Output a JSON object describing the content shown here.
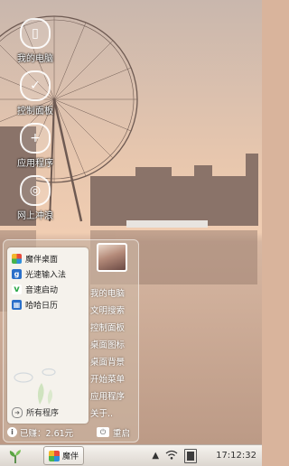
{
  "desktop": {
    "icons": [
      {
        "label": "我的电脑",
        "icon": "phone-icon"
      },
      {
        "label": "控制面板",
        "icon": "check-shield-icon"
      },
      {
        "label": "应用程序",
        "icon": "plus-icon"
      },
      {
        "label": "网上冲浪",
        "icon": "globe-icon"
      }
    ]
  },
  "start_menu": {
    "apps": [
      {
        "label": "魔伴桌面",
        "icon": "pinwheel-icon",
        "color": "#e94b3c"
      },
      {
        "label": "光速输入法",
        "icon": "input-g-icon",
        "color": "#2a6fc9"
      },
      {
        "label": "音速启动",
        "icon": "v-check-icon",
        "color": "#2ea84a"
      },
      {
        "label": "哈哈日历",
        "icon": "calendar-icon",
        "color": "#2a6fc9"
      }
    ],
    "all_programs": "所有程序",
    "side_items": [
      "我的电脑",
      "文明搜索",
      "控制面板",
      "桌面图标",
      "桌面背景",
      "开始菜单",
      "应用程序",
      "关于.."
    ],
    "footer": {
      "earned": "已赚：2.61元",
      "reboot": "重启"
    }
  },
  "taskbar": {
    "app_label": "魔伴",
    "clock": "17:12:32"
  },
  "colors": {
    "sky": "#e9c2a6",
    "water": "#c9a791",
    "taskbar": "#efebe6"
  }
}
